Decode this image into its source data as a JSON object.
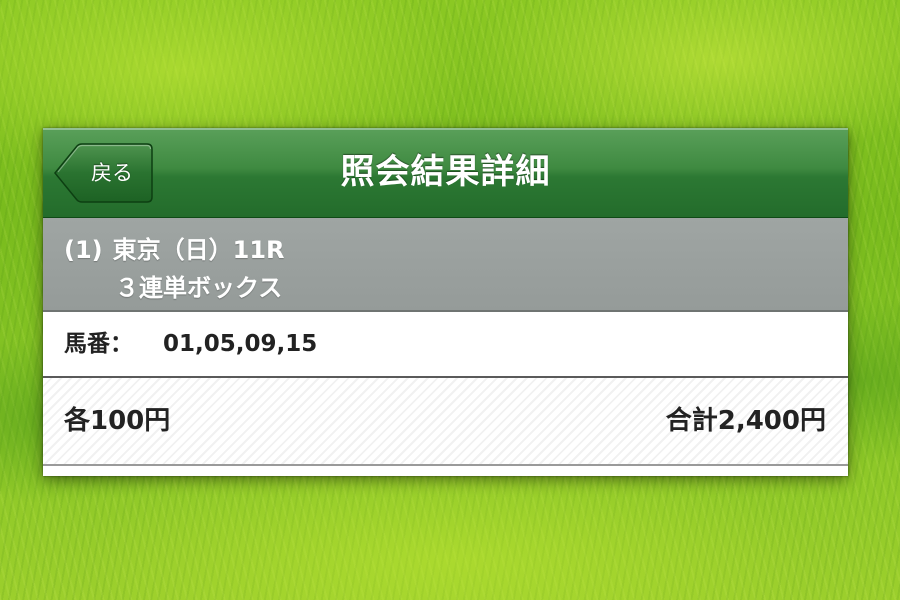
{
  "background": {
    "description_icon": "grass-background"
  },
  "colors": {
    "navbar_green": "#2c7833",
    "header_gray": "#9fa5a3",
    "text_dark": "#222222",
    "text_white": "#ffffff"
  },
  "navbar": {
    "back_label": "戻る",
    "title": "照会結果詳細"
  },
  "race": {
    "number": "(1)",
    "venue_day_race": "東京（日）11R",
    "bet_type": "３連単ボックス"
  },
  "selection": {
    "label": "馬番：",
    "numbers": "01,05,09,15"
  },
  "amounts": {
    "unit": "各100円",
    "total": "合計2,400円"
  }
}
